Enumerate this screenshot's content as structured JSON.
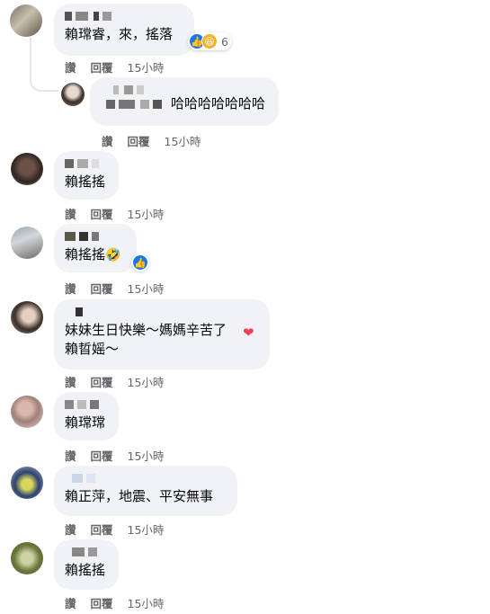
{
  "comments": [
    {
      "text": "賴瑺睿，來，搖落",
      "actions": [
        "讚",
        "回覆"
      ],
      "time": "15小時",
      "reaction_count": "6"
    },
    {
      "text": "哈哈哈哈哈哈哈",
      "actions": [
        "讚",
        "回覆"
      ],
      "time": "15小時"
    },
    {
      "text": "賴搖搖",
      "actions": [
        "讚",
        "回覆"
      ],
      "time": "15小時"
    },
    {
      "text": "賴搖搖",
      "actions": [
        "讚",
        "回覆"
      ],
      "time": "15小時"
    },
    {
      "text": "妹妹生日快樂～媽媽辛苦了\n賴晢媱～",
      "actions": [
        "讚",
        "回覆"
      ],
      "time": "15小時"
    },
    {
      "text": "賴瑺瑺",
      "actions": [
        "讚",
        "回覆"
      ],
      "time": "15小時"
    },
    {
      "text": "賴正萍，地震、平安無事",
      "actions": [
        "讚",
        "回覆"
      ],
      "time": "15小時"
    },
    {
      "text": "賴搖搖",
      "actions": [
        "讚",
        "回覆"
      ],
      "time": "15小時"
    }
  ],
  "colors": {
    "like": "#1877f2",
    "haha": "#f7b125",
    "heart": "#f33e58",
    "bubble": "#f0f2f5",
    "meta": "#65676b"
  },
  "icons": [
    "like-icon",
    "haha-icon",
    "laughing-emoji-icon",
    "heart-emoji-icon"
  ]
}
